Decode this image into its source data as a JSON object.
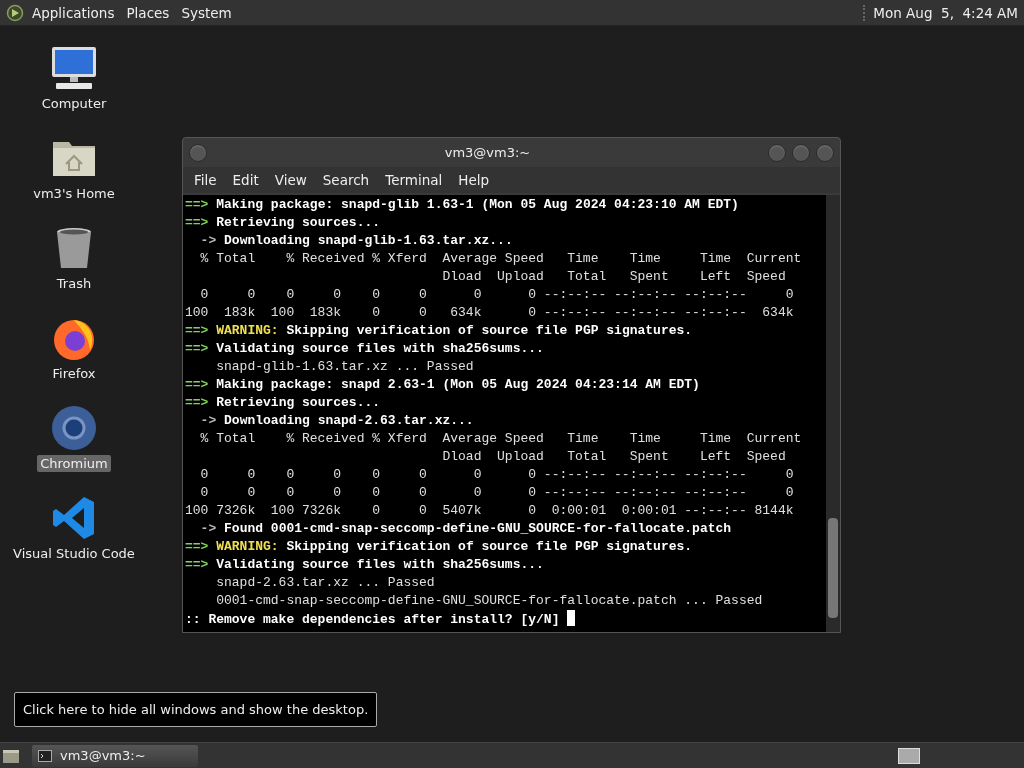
{
  "top_panel": {
    "menus": [
      "Applications",
      "Places",
      "System"
    ],
    "clock": "Mon Aug  5,  4:24 AM"
  },
  "desktop_icons": [
    {
      "kind": "computer",
      "label": "Computer",
      "selected": false
    },
    {
      "kind": "home",
      "label": "vm3's Home",
      "selected": false
    },
    {
      "kind": "trash",
      "label": "Trash",
      "selected": false
    },
    {
      "kind": "firefox",
      "label": "Firefox",
      "selected": false
    },
    {
      "kind": "chromium",
      "label": "Chromium",
      "selected": true
    },
    {
      "kind": "vscode",
      "label": "Visual Studio Code",
      "selected": false
    }
  ],
  "terminal": {
    "title": "vm3@vm3:~",
    "menus": [
      "File",
      "Edit",
      "View",
      "Search",
      "Terminal",
      "Help"
    ],
    "lines": [
      {
        "kind": "header",
        "prefix": "==>",
        "text": "Making package: snapd-glib 1.63-1 (Mon 05 Aug 2024 04:23:10 AM EDT)"
      },
      {
        "kind": "header",
        "prefix": "==>",
        "text": "Retrieving sources..."
      },
      {
        "kind": "step",
        "prefix": "  ->",
        "text": "Downloading snapd-glib-1.63.tar.xz..."
      },
      {
        "kind": "plain",
        "text": "  % Total    % Received % Xferd  Average Speed   Time    Time     Time  Current"
      },
      {
        "kind": "plain",
        "text": "                                 Dload  Upload   Total   Spent    Left  Speed"
      },
      {
        "kind": "plain",
        "text": "  0     0    0     0    0     0      0      0 --:--:-- --:--:-- --:--:--     0"
      },
      {
        "kind": "plain",
        "text": "100  183k  100  183k    0     0   634k      0 --:--:-- --:--:-- --:--:--  634k"
      },
      {
        "kind": "warning",
        "prefix": "==>",
        "label": "WARNING:",
        "text": "Skipping verification of source file PGP signatures."
      },
      {
        "kind": "header",
        "prefix": "==>",
        "text": "Validating source files with sha256sums..."
      },
      {
        "kind": "plain",
        "text": "    snapd-glib-1.63.tar.xz ... Passed"
      },
      {
        "kind": "header",
        "prefix": "==>",
        "text": "Making package: snapd 2.63-1 (Mon 05 Aug 2024 04:23:14 AM EDT)"
      },
      {
        "kind": "header",
        "prefix": "==>",
        "text": "Retrieving sources..."
      },
      {
        "kind": "step",
        "prefix": "  ->",
        "text": "Downloading snapd-2.63.tar.xz..."
      },
      {
        "kind": "plain",
        "text": "  % Total    % Received % Xferd  Average Speed   Time    Time     Time  Current"
      },
      {
        "kind": "plain",
        "text": "                                 Dload  Upload   Total   Spent    Left  Speed"
      },
      {
        "kind": "plain",
        "text": "  0     0    0     0    0     0      0      0 --:--:-- --:--:-- --:--:--     0"
      },
      {
        "kind": "plain",
        "text": "  0     0    0     0    0     0      0      0 --:--:-- --:--:-- --:--:--     0"
      },
      {
        "kind": "plain",
        "text": "100 7326k  100 7326k    0     0  5407k      0  0:00:01  0:00:01 --:--:-- 8144k"
      },
      {
        "kind": "step",
        "prefix": "  ->",
        "text": "Found 0001-cmd-snap-seccomp-define-GNU_SOURCE-for-fallocate.patch"
      },
      {
        "kind": "warning",
        "prefix": "==>",
        "label": "WARNING:",
        "text": "Skipping verification of source file PGP signatures."
      },
      {
        "kind": "header",
        "prefix": "==>",
        "text": "Validating source files with sha256sums..."
      },
      {
        "kind": "plain",
        "text": "    snapd-2.63.tar.xz ... Passed"
      },
      {
        "kind": "plain",
        "text": "    0001-cmd-snap-seccomp-define-GNU_SOURCE-for-fallocate.patch ... Passed"
      },
      {
        "kind": "prompt",
        "text": ":: Remove make dependencies after install? [y/N]"
      }
    ]
  },
  "tooltip": "Click here to hide all windows and show the desktop.",
  "taskbar": {
    "tasks": [
      {
        "label": "vm3@vm3:~",
        "selected": false
      }
    ]
  }
}
